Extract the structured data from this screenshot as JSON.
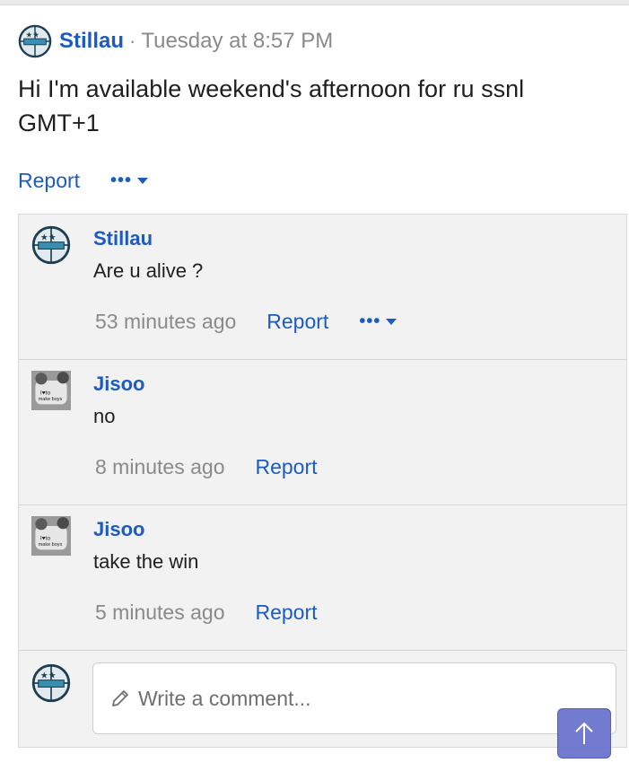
{
  "post": {
    "author": "Stillau",
    "separator": "·",
    "time": "Tuesday at 8:57 PM",
    "body": "Hi I'm available weekend's afternoon for ru ssnl GMT+1",
    "report_label": "Report",
    "more_label": "•••"
  },
  "comments": [
    {
      "author": "Stillau",
      "text": "Are u alive ?",
      "time": "53 minutes ago",
      "report_label": "Report",
      "more_label": "•••",
      "avatar": "stillau-avatar"
    },
    {
      "author": "Jisoo",
      "text": "no",
      "time": "8 minutes ago",
      "report_label": "Report",
      "avatar": "jisoo-avatar"
    },
    {
      "author": "Jisoo",
      "text": "take the win",
      "time": "5 minutes ago",
      "report_label": "Report",
      "avatar": "jisoo-avatar"
    }
  ],
  "composer": {
    "placeholder": "Write a comment..."
  },
  "colors": {
    "link": "#1d5bbf",
    "muted": "#8a8a8a",
    "panel": "#f2f2f2",
    "scroll_button": "#6c74cf"
  },
  "icons": {
    "pencil": "pencil-icon",
    "arrow_up": "arrow-up-icon",
    "caret": "caret-down-icon"
  }
}
